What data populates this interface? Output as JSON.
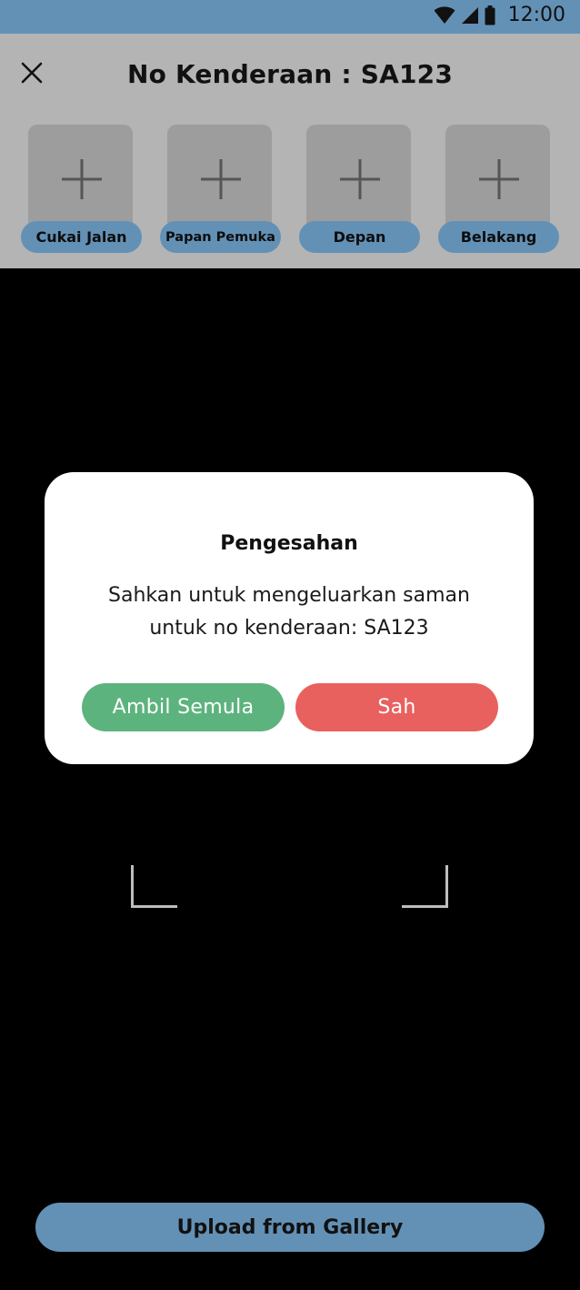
{
  "status_bar": {
    "time": "12:00",
    "icons": [
      "wifi-icon",
      "signal-icon",
      "battery-icon"
    ],
    "background": "#6391b6"
  },
  "header": {
    "title": "No Kenderaan : SA123",
    "close_icon": "close-icon",
    "background": "#b4b4b4"
  },
  "photo_slots": [
    {
      "label": "Cukai Jalan",
      "icon": "plus-icon"
    },
    {
      "label": "Papan Pemuka",
      "icon": "plus-icon"
    },
    {
      "label": "Depan",
      "icon": "plus-icon"
    },
    {
      "label": "Belakang",
      "icon": "plus-icon"
    }
  ],
  "dialog": {
    "title": "Pengesahan",
    "message": "Sahkan untuk mengeluarkan saman untuk no kenderaan: SA123",
    "retake_label": "Ambil Semula",
    "confirm_label": "Sah",
    "retake_color": "#5db37e",
    "confirm_color": "#e8615f"
  },
  "upload": {
    "label": "Upload from Gallery"
  },
  "colors": {
    "accent": "#6391b6",
    "camera_background": "#000000"
  }
}
